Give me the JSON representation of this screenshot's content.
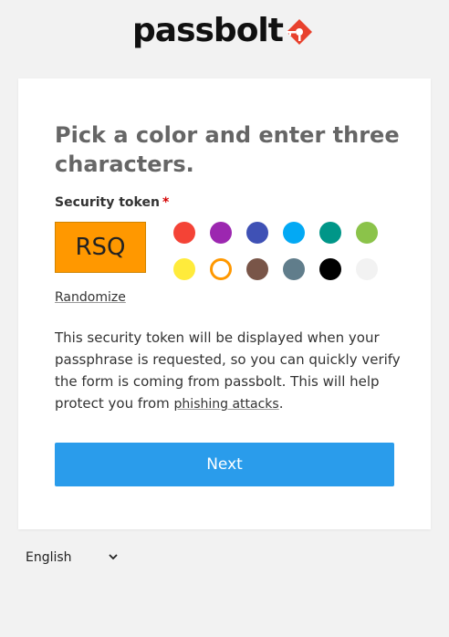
{
  "header": {
    "logo_text": "passbolt"
  },
  "form": {
    "title": "Pick a color and enter three characters.",
    "field_label": "Security token",
    "required_marker": "*",
    "token_value": "RSQ",
    "token_color": "#ff9800",
    "palette": [
      "#f44336",
      "#9c27b0",
      "#3f51b5",
      "#03a9f4",
      "#009688",
      "#8bc34a",
      "#ffeb3b",
      "#ff9800",
      "#795548",
      "#607d8b",
      "#000000",
      "#f2f2f2"
    ],
    "selected_color": "#ff9800",
    "randomize_label": "Randomize",
    "help_text_part1": "This security token will be displayed when your passphrase is requested, so you can quickly verify the form is coming from passbolt. This will help protect you from ",
    "help_link": "phishing attacks",
    "help_text_part2": ".",
    "next_label": "Next"
  },
  "footer": {
    "language": "English"
  },
  "colors": {
    "background": "#f2f2f2",
    "card": "#ffffff",
    "primary": "#2a9ceb",
    "brand_accent": "#e8412d",
    "required": "#d40101"
  }
}
